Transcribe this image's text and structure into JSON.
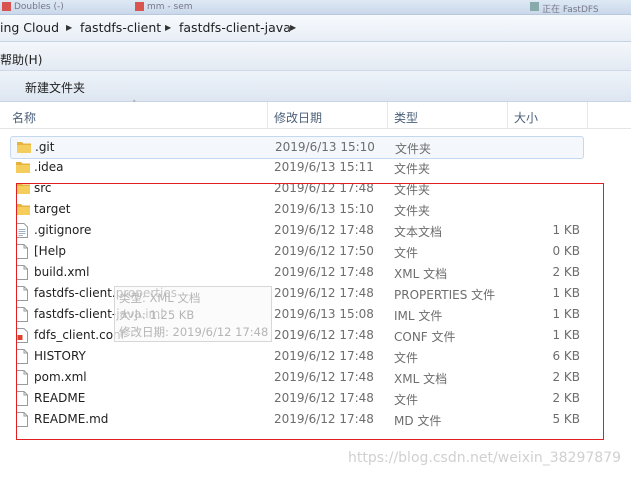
{
  "taskbar": {
    "items": [
      "Doubles (-)",
      "mm - sem",
      "",
      "",
      "",
      "",
      "",
      "",
      "正在 FastDFS"
    ]
  },
  "breadcrumb": {
    "items": [
      "ing Cloud",
      "fastdfs-client",
      "fastdfs-client-java"
    ]
  },
  "menu": {
    "help": "帮助(H)"
  },
  "toolbar": {
    "new_folder": "新建文件夹"
  },
  "columns": {
    "name": "名称",
    "date": "修改日期",
    "type": "类型",
    "size": "大小"
  },
  "files": [
    {
      "name": ".git",
      "date": "2019/6/13 15:10",
      "type": "文件夹",
      "size": "",
      "icon": "folder-icon"
    },
    {
      "name": ".idea",
      "date": "2019/6/13 15:11",
      "type": "文件夹",
      "size": "",
      "icon": "folder-icon"
    },
    {
      "name": "src",
      "date": "2019/6/12 17:48",
      "type": "文件夹",
      "size": "",
      "icon": "folder-icon"
    },
    {
      "name": "target",
      "date": "2019/6/13 15:10",
      "type": "文件夹",
      "size": "",
      "icon": "folder-icon"
    },
    {
      "name": ".gitignore",
      "date": "2019/6/12 17:48",
      "type": "文本文档",
      "size": "1 KB",
      "icon": "text-file-icon"
    },
    {
      "name": "[Help",
      "date": "2019/6/12 17:50",
      "type": "文件",
      "size": "0 KB",
      "icon": "file-icon"
    },
    {
      "name": "build.xml",
      "date": "2019/6/12 17:48",
      "type": "XML 文档",
      "size": "2 KB",
      "icon": "file-icon"
    },
    {
      "name": "fastdfs-client.properties",
      "date": "2019/6/12 17:48",
      "type": "PROPERTIES 文件",
      "size": "1 KB",
      "icon": "file-icon"
    },
    {
      "name": "fastdfs-client-java.iml",
      "date": "2019/6/13 15:08",
      "type": "IML 文件",
      "size": "1 KB",
      "icon": "file-icon"
    },
    {
      "name": "fdfs_client.conf",
      "date": "2019/6/12 17:48",
      "type": "CONF 文件",
      "size": "1 KB",
      "icon": "conf-file-icon"
    },
    {
      "name": "HISTORY",
      "date": "2019/6/12 17:48",
      "type": "文件",
      "size": "6 KB",
      "icon": "file-icon"
    },
    {
      "name": "pom.xml",
      "date": "2019/6/12 17:48",
      "type": "XML 文档",
      "size": "2 KB",
      "icon": "file-icon"
    },
    {
      "name": "README",
      "date": "2019/6/12 17:48",
      "type": "文件",
      "size": "2 KB",
      "icon": "file-icon"
    },
    {
      "name": "README.md",
      "date": "2019/6/12 17:48",
      "type": "MD 文件",
      "size": "5 KB",
      "icon": "file-icon"
    }
  ],
  "tooltip": {
    "line1": "类型: XML 文档",
    "line2": "大小: 1.25 KB",
    "line3": "修改日期: 2019/6/12 17:48"
  },
  "watermark": "https://blog.csdn.net/weixin_38297879",
  "colors": {
    "highlight_box": "#e02020",
    "selection": "#c4d8ef",
    "folder": "#e8b33c"
  }
}
